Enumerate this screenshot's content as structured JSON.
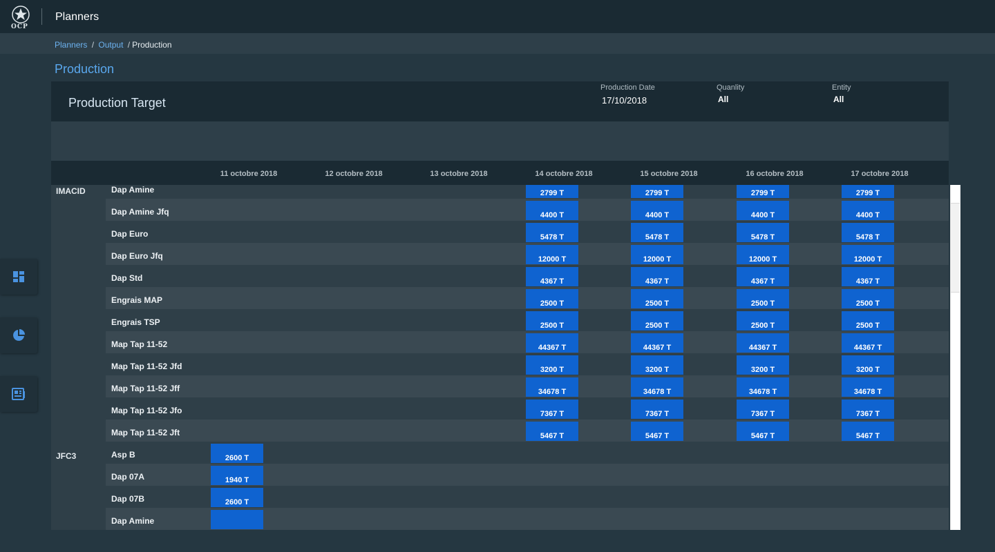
{
  "app": {
    "logo_text": "OCP",
    "title": "Planners"
  },
  "breadcrumb": {
    "planners": "Planners",
    "output": "Output",
    "current": "Production",
    "separator": "/"
  },
  "page_title": "Production",
  "sidebar_icons": [
    "dashboard-icon",
    "pie-chart-icon",
    "report-icon"
  ],
  "panel": {
    "title": "Production Target",
    "filters": {
      "production_date_label": "Production Date",
      "production_date_value": "17/10/2018",
      "quantity_label": "Quanlity",
      "quantity_value": "All",
      "entity_label": "Entity",
      "entity_value": "All"
    }
  },
  "dates": [
    "11 octobre 2018",
    "12 octobre 2018",
    "13 octobre 2018",
    "14 octobre 2018",
    "15 octobre 2018",
    "16 octobre 2018",
    "17 octobre 2018"
  ],
  "groups": [
    {
      "entity": "IMACID",
      "rows": [
        {
          "product": "Dap Amine",
          "values": [
            "",
            "",
            "",
            "2799 T",
            "2799 T",
            "2799 T",
            "2799 T"
          ]
        },
        {
          "product": "Dap Amine Jfq",
          "values": [
            "",
            "",
            "",
            "4400 T",
            "4400 T",
            "4400 T",
            "4400 T"
          ]
        },
        {
          "product": "Dap Euro",
          "values": [
            "",
            "",
            "",
            "5478 T",
            "5478 T",
            "5478 T",
            "5478 T"
          ]
        },
        {
          "product": "Dap Euro Jfq",
          "values": [
            "",
            "",
            "",
            "12000 T",
            "12000 T",
            "12000 T",
            "12000 T"
          ]
        },
        {
          "product": "Dap Std",
          "values": [
            "",
            "",
            "",
            "4367 T",
            "4367 T",
            "4367 T",
            "4367 T"
          ]
        },
        {
          "product": "Engrais MAP",
          "values": [
            "",
            "",
            "",
            "2500 T",
            "2500 T",
            "2500 T",
            "2500 T"
          ]
        },
        {
          "product": "Engrais TSP",
          "values": [
            "",
            "",
            "",
            "2500 T",
            "2500 T",
            "2500 T",
            "2500 T"
          ]
        },
        {
          "product": "Map Tap 11-52",
          "values": [
            "",
            "",
            "",
            "44367 T",
            "44367 T",
            "44367 T",
            "44367 T"
          ]
        },
        {
          "product": "Map Tap 11-52 Jfd",
          "values": [
            "",
            "",
            "",
            "3200 T",
            "3200 T",
            "3200 T",
            "3200 T"
          ]
        },
        {
          "product": "Map Tap 11-52 Jff",
          "values": [
            "",
            "",
            "",
            "34678 T",
            "34678 T",
            "34678 T",
            "34678 T"
          ]
        },
        {
          "product": "Map Tap 11-52 Jfo",
          "values": [
            "",
            "",
            "",
            "7367 T",
            "7367 T",
            "7367 T",
            "7367 T"
          ]
        },
        {
          "product": "Map Tap 11-52 Jft",
          "values": [
            "",
            "",
            "",
            "5467 T",
            "5467 T",
            "5467 T",
            "5467 T"
          ]
        }
      ]
    },
    {
      "entity": "JFC3",
      "rows": [
        {
          "product": "Asp B",
          "values": [
            "2600 T",
            "",
            "",
            "",
            "",
            "",
            ""
          ]
        },
        {
          "product": "Dap 07A",
          "values": [
            "1940 T",
            "",
            "",
            "",
            "",
            "",
            ""
          ]
        },
        {
          "product": "Dap 07B",
          "values": [
            "2600 T",
            "",
            "",
            "",
            "",
            "",
            ""
          ]
        },
        {
          "product": "Dap Amine",
          "values": [
            "",
            "",
            "",
            "",
            "",
            "",
            ""
          ]
        }
      ]
    }
  ],
  "colors": {
    "background": "#253741",
    "header": "#1a2a33",
    "accent": "#5aa8ee",
    "cell": "#0f63d0"
  }
}
